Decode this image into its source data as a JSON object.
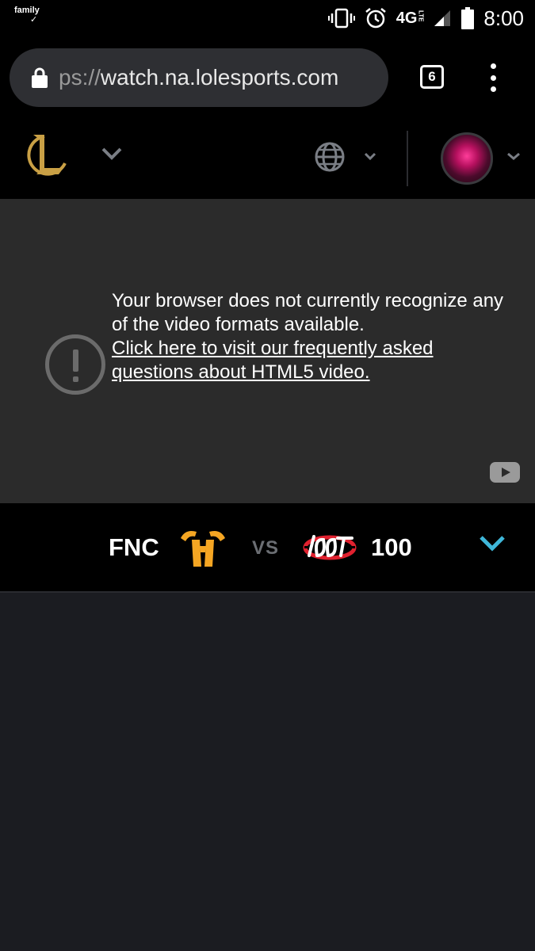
{
  "status_bar": {
    "notification_label": "family",
    "notification_mark": "✓",
    "network": "4G",
    "network_sub": "LTE",
    "time": "8:00",
    "icons": [
      "vibrate-icon",
      "alarm-icon",
      "network-icon",
      "signal-icon",
      "battery-icon"
    ]
  },
  "browser": {
    "url_scheme": "ps://",
    "url_host": "watch.na.lolesports.com",
    "tab_count": "6"
  },
  "site_nav": {
    "logo": "lol-logo",
    "icons": [
      "chevron-down-icon",
      "globe-icon",
      "avatar"
    ]
  },
  "player": {
    "error_message": "Your browser does not currently recognize any of the video formats available.",
    "error_link": "Click here to visit our frequently asked questions about HTML5 video."
  },
  "match": {
    "team1": "FNC",
    "vs": "VS",
    "team2": "100"
  },
  "colors": {
    "page_bg": "#1b1c21",
    "bar_bg": "#000000",
    "player_bg": "#2b2b2b",
    "lol_gold": "#c9a045",
    "fnatic_orange": "#f5a623",
    "hundred_red": "#e0212f",
    "accent_blue": "#3fb7d9"
  }
}
